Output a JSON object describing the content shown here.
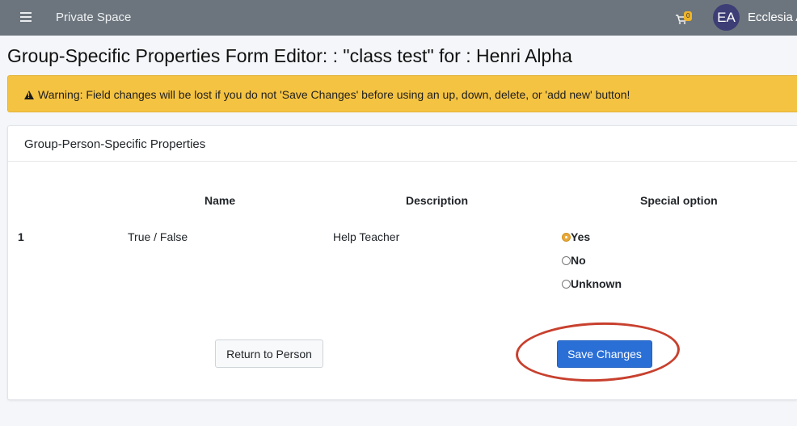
{
  "navbar": {
    "brand": "Private Space",
    "cart_count": "0",
    "avatar_initials": "EA",
    "user_name": "Ecclesia A"
  },
  "page": {
    "title": "Group-Specific Properties Form Editor: : \"class test\" for : Henri Alpha"
  },
  "alert": {
    "text": "Warning: Field changes will be lost if you do not 'Save Changes' before using an up, down, delete, or 'add new' button!"
  },
  "card": {
    "title": "Group-Person-Specific Properties",
    "columns": {
      "name": "Name",
      "description": "Description",
      "special": "Special option"
    },
    "row": {
      "index": "1",
      "name": "True / False",
      "description": "Help Teacher",
      "options": [
        {
          "label": "Yes",
          "checked": true
        },
        {
          "label": "No",
          "checked": false
        },
        {
          "label": "Unknown",
          "checked": false
        }
      ]
    },
    "buttons": {
      "return": "Return to Person",
      "save": "Save Changes"
    }
  },
  "colors": {
    "navbar": "#6c757d",
    "warning": "#f5c342",
    "primary": "#2a6fd6",
    "annotation": "#c8402e"
  }
}
